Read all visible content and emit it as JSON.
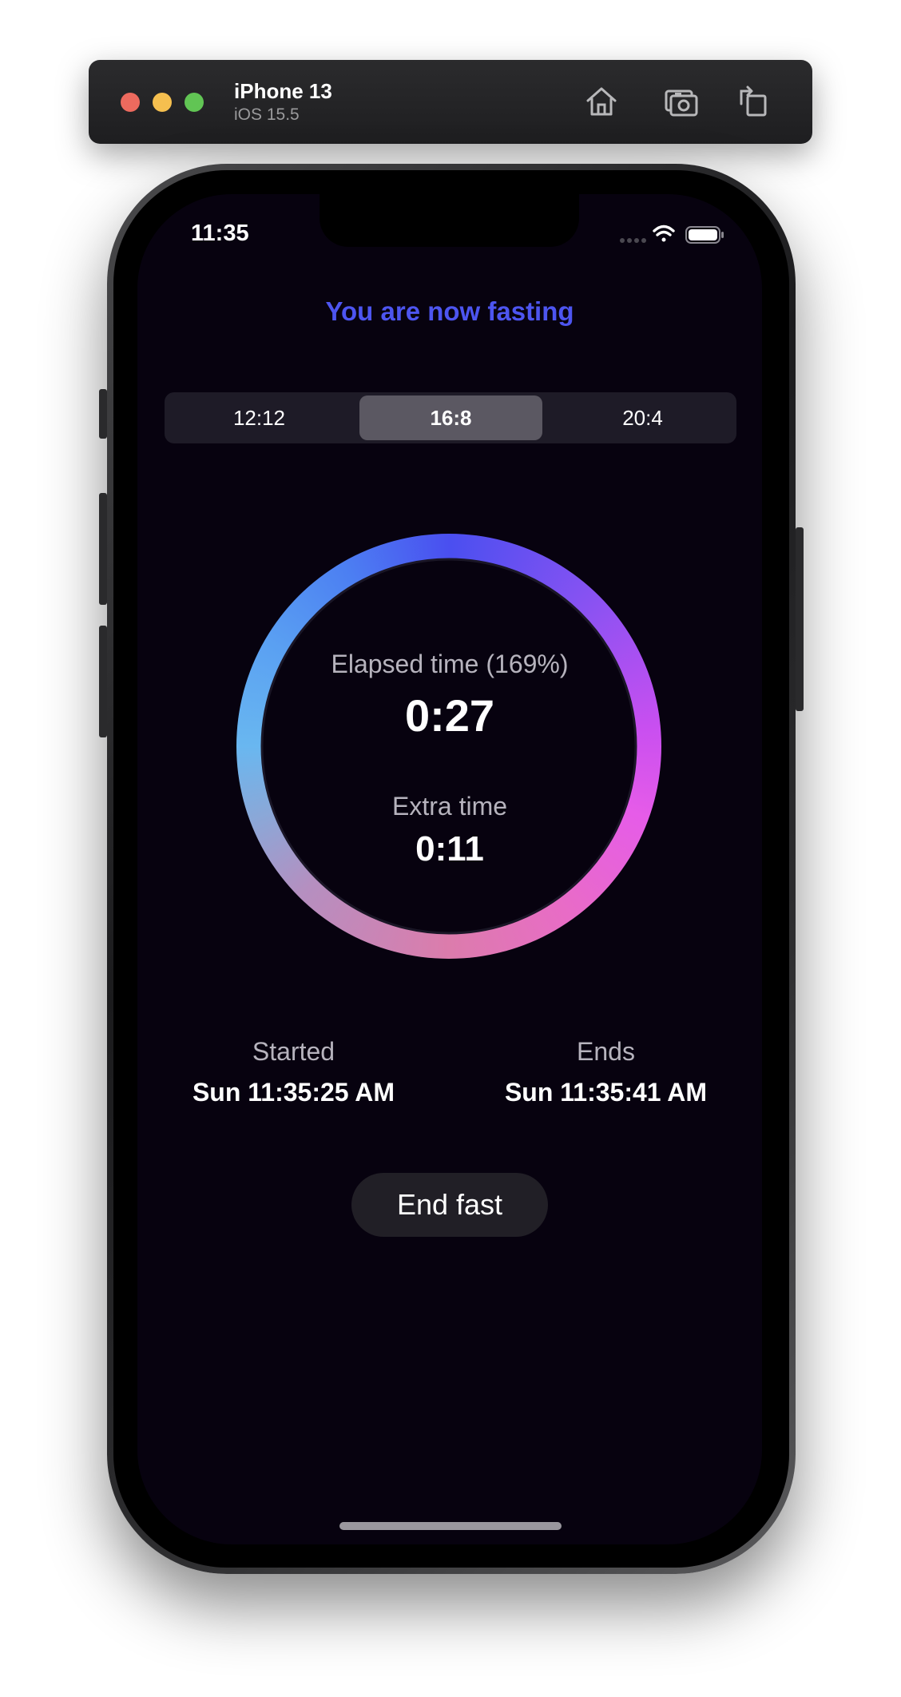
{
  "simulator": {
    "device_name": "iPhone 13",
    "os_version": "iOS 15.5",
    "buttons": [
      "home-icon",
      "screenshot-icon",
      "rotate-icon"
    ]
  },
  "status_bar": {
    "time": "11:35",
    "icons": [
      "signal-icon",
      "wifi-icon",
      "battery-icon"
    ]
  },
  "app": {
    "headline": "You are now fasting",
    "headline_color": "#4d55f0",
    "plans": [
      {
        "label": "12:12",
        "selected": false
      },
      {
        "label": "16:8",
        "selected": true
      },
      {
        "label": "20:4",
        "selected": false
      }
    ],
    "progress": {
      "elapsed_label": "Elapsed time (169%)",
      "elapsed_value": "0:27",
      "extra_label": "Extra time",
      "extra_value": "0:11",
      "fill_fraction": 1.0,
      "gradient_colors": [
        "#4a4ff0",
        "#c94ff0",
        "#e65ccc",
        "#d780a8",
        "#9f95c8",
        "#69b7f0"
      ]
    },
    "started": {
      "label": "Started",
      "value": "Sun 11:35:25 AM"
    },
    "ends": {
      "label": "Ends",
      "value": "Sun 11:35:41 AM"
    },
    "end_button": "End fast"
  }
}
